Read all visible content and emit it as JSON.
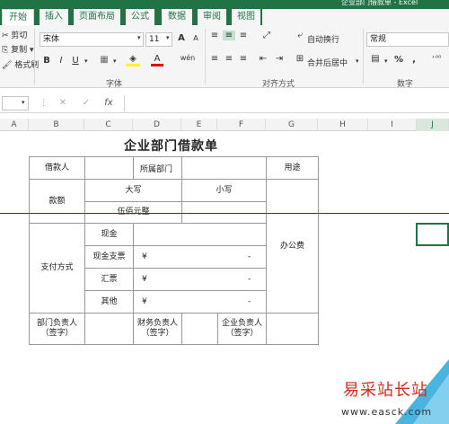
{
  "window": {
    "title": "企业部门借款单 - Excel"
  },
  "tabs": [
    {
      "label": "开始",
      "active": true
    },
    {
      "label": "插入"
    },
    {
      "label": "页面布局"
    },
    {
      "label": "公式"
    },
    {
      "label": "数据"
    },
    {
      "label": "审阅"
    },
    {
      "label": "视图"
    }
  ],
  "ribbon": {
    "clipboard": {
      "cut": "剪切",
      "copy": "复制",
      "format_painter": "格式刷"
    },
    "font": {
      "name": "宋体",
      "size": "11",
      "bold": "B",
      "italic": "I",
      "underline": "U",
      "grow": "A",
      "shrink": "A",
      "phonetic": "wén",
      "group_label": "字体"
    },
    "alignment": {
      "wrap": "自动换行",
      "merge": "合并后居中",
      "group_label": "对齐方式"
    },
    "number": {
      "format": "常规",
      "percent": "%",
      "comma": ",",
      "group_label": "数字"
    }
  },
  "formula_bar": {
    "name_box": "",
    "fx": "fx",
    "cancel": "✕",
    "confirm": "✓"
  },
  "columns": [
    "A",
    "B",
    "C",
    "D",
    "E",
    "F",
    "G",
    "H",
    "I",
    "J"
  ],
  "form": {
    "title": "企业部门借款单",
    "borrower": "借款人",
    "department": "所属部门",
    "purpose": "用途",
    "amount": "款额",
    "upper": "大写",
    "lower": "小写",
    "amount_text": "伍佰元整",
    "purpose_value": "办公费",
    "payment": "支付方式",
    "cash": "现金",
    "cheque": "现金支票",
    "draft": "汇票",
    "other": "其他",
    "yen": "¥",
    "dash": "-",
    "dept_head": "部门负责人\n（签字）",
    "finance_head": "财务负责人\n（签字）",
    "company_head": "企业负责人\n（签字）"
  },
  "watermark": {
    "name": "易采站长站",
    "url": "www.easck.com"
  }
}
